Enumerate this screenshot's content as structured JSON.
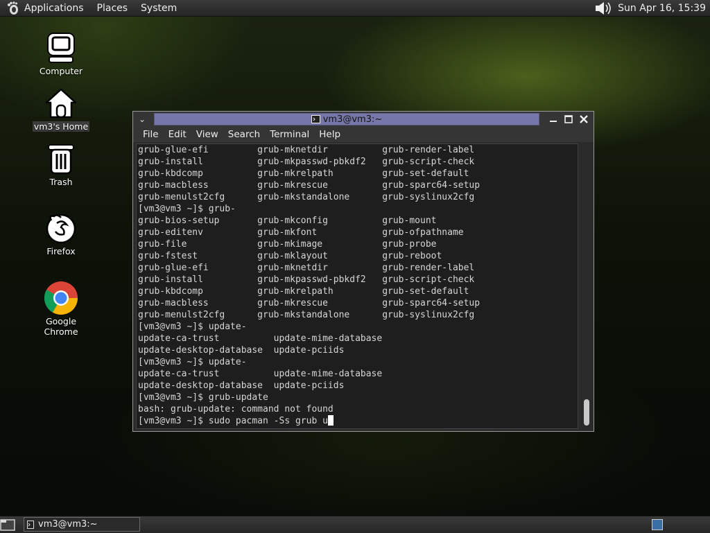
{
  "top_panel": {
    "menus": [
      "Applications",
      "Places",
      "System"
    ],
    "clock": "Sun Apr 16, 15:39"
  },
  "desktop_icons": [
    {
      "label": "Computer",
      "icon": "computer-icon"
    },
    {
      "label": "vm3's Home",
      "icon": "home-icon"
    },
    {
      "label": "Trash",
      "icon": "trash-icon"
    },
    {
      "label": "Firefox",
      "icon": "firefox-icon"
    },
    {
      "label": "Google Chrome",
      "icon": "chrome-icon"
    }
  ],
  "terminal": {
    "title": "vm3@vm3:~",
    "menu": [
      "File",
      "Edit",
      "View",
      "Search",
      "Terminal",
      "Help"
    ],
    "lines": [
      "grub-glue-efi         grub-mknetdir          grub-render-label",
      "grub-install          grub-mkpasswd-pbkdf2   grub-script-check",
      "grub-kbdcomp          grub-mkrelpath         grub-set-default",
      "grub-macbless         grub-mkrescue          grub-sparc64-setup",
      "grub-menulst2cfg      grub-mkstandalone      grub-syslinux2cfg",
      "[vm3@vm3 ~]$ grub-",
      "grub-bios-setup       grub-mkconfig          grub-mount",
      "grub-editenv          grub-mkfont            grub-ofpathname",
      "grub-file             grub-mkimage           grub-probe",
      "grub-fstest           grub-mklayout          grub-reboot",
      "grub-glue-efi         grub-mknetdir          grub-render-label",
      "grub-install          grub-mkpasswd-pbkdf2   grub-script-check",
      "grub-kbdcomp          grub-mkrelpath         grub-set-default",
      "grub-macbless         grub-mkrescue          grub-sparc64-setup",
      "grub-menulst2cfg      grub-mkstandalone      grub-syslinux2cfg",
      "[vm3@vm3 ~]$ update-",
      "update-ca-trust          update-mime-database",
      "update-desktop-database  update-pciids",
      "[vm3@vm3 ~]$ update-",
      "update-ca-trust          update-mime-database",
      "update-desktop-database  update-pciids",
      "[vm3@vm3 ~]$ grub-update",
      "bash: grub-update: command not found"
    ],
    "prompt_line": "[vm3@vm3 ~]$ sudo pacman -Ss grub u"
  },
  "taskbar": {
    "task_label": "vm3@vm3:~"
  },
  "colors": {
    "panel": "#2f2f2f",
    "title_strip": "#7776a8",
    "terminal_bg": "#1e1e1e",
    "workspace_active": "#3a6ea5"
  }
}
